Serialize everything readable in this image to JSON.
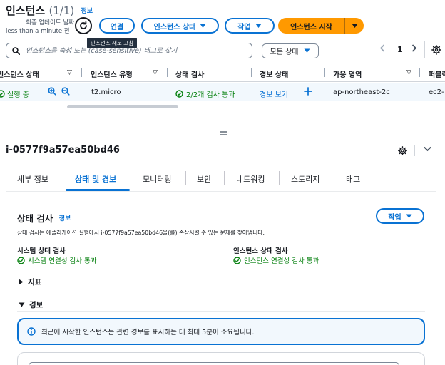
{
  "header": {
    "title": "인스턴스",
    "count": "(1/1)",
    "info_label": "정보",
    "last_updated_label": "최종 업데이트 날짜",
    "last_updated_value": "less than a minute 전",
    "refresh_tooltip": "인스턴스 새로 고침",
    "connect_label": "연결",
    "instance_state_label": "인스턴스 상태",
    "actions_label": "작업",
    "launch_label": "인스턴스 시작"
  },
  "search": {
    "placeholder": "인스턴스을 속성 또는 (case-sensitive) 태그로 찾기",
    "state_filter": "모든 상태"
  },
  "pagination": {
    "current_page": "1"
  },
  "table": {
    "headers": {
      "state": "인스턴스 상태",
      "type": "인스턴스 유형",
      "status_check": "상태 검사",
      "alarm_status": "경보 상태",
      "az": "가용 영역",
      "public_dns": "퍼블릭"
    },
    "rows": [
      {
        "state": "실행 중",
        "type": "t2.micro",
        "status_check": "2/2개 검사 통과",
        "alarm": "경보 보기",
        "az": "ap-northeast-2c",
        "public_dns": "ec2-"
      }
    ]
  },
  "details": {
    "instance_id": "i-0577f9a57ea50bd46",
    "tabs": [
      "세부 정보",
      "상태 및 경보",
      "모니터링",
      "보안",
      "네트워킹",
      "스토리지",
      "태그"
    ],
    "active_tab": 1,
    "status_checks": {
      "title": "상태 검사",
      "info_label": "정보",
      "actions_label": "작업",
      "description": "상태 검사는 애플리케이션 실행에서 i-0577f9a57ea50bd46을(를) 손상시킬 수 있는 문제를 찾아냅니다.",
      "system_label": "시스템 상태 검사",
      "system_value": "시스템 연결성 검사 통과",
      "instance_label": "인스턴스 상태 검사",
      "instance_value": "인스턴스 연결성 검사 통과"
    },
    "metrics_label": "지표",
    "alarms_label": "경보",
    "alarm_info": "최근에 시작한 인스턴스는 관련 경보를 표시하는 데 최대 5분이 소요됩니다."
  },
  "colors": {
    "accent": "#0972d3",
    "primary_button": "#ff9900",
    "success": "#037f0c"
  },
  "icons": [
    "refresh-icon",
    "search-icon",
    "settings-gear-icon",
    "chevron-down-icon",
    "check-circle-icon",
    "zoom-in-icon",
    "zoom-out-icon",
    "info-circle-icon",
    "plus-icon"
  ]
}
